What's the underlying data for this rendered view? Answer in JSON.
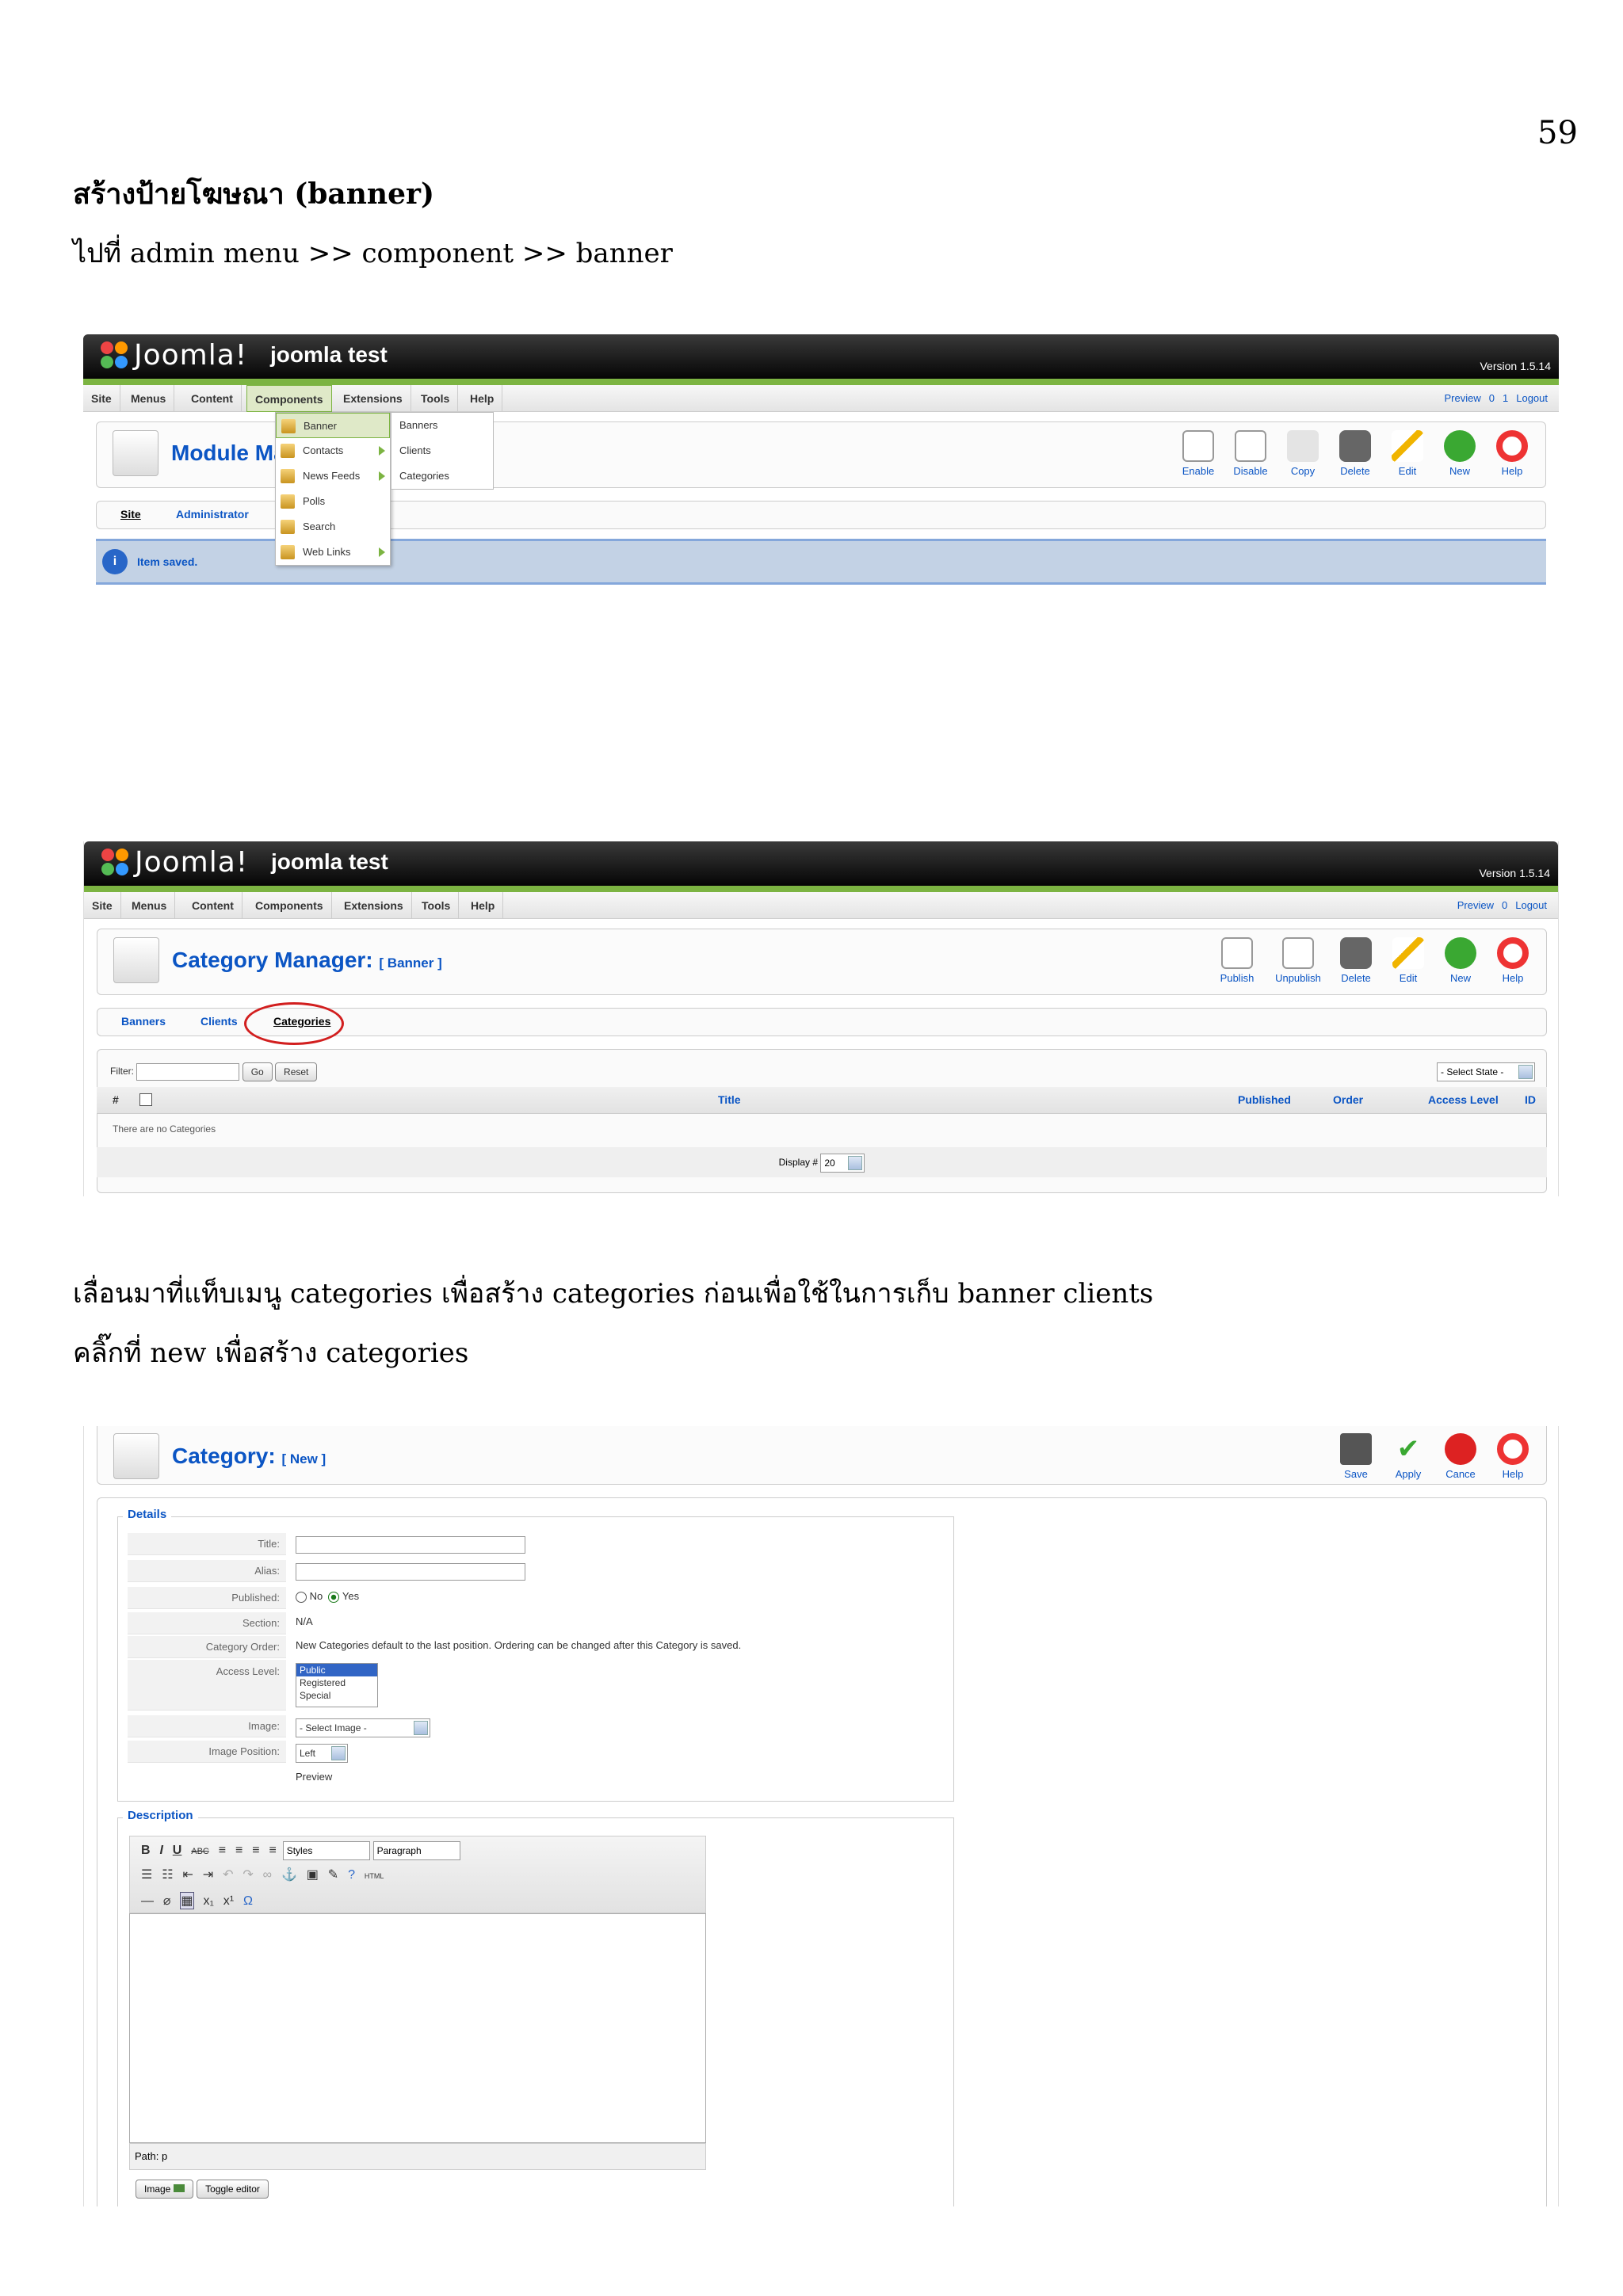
{
  "page": {
    "number": "59",
    "heading": "สร้างป้ายโฆษณา (banner)",
    "subline": "ไปที่ admin menu >> component >> banner",
    "para1": "เลื่อนมาที่แท็บเมนู categories เพื่อสร้าง categories ก่อนเพื่อใช้ในการเก็บ banner clients",
    "para2": "คลิ๊กที่ new เพื่อสร้าง categories"
  },
  "joomla": {
    "logo_text": "Joomla!",
    "site_name": "joomla test",
    "version": "Version 1.5.14",
    "menu": [
      "Site",
      "Menus",
      "Content",
      "Components",
      "Extensions",
      "Tools",
      "Help"
    ],
    "right_links": {
      "preview": "Preview",
      "count1": "0",
      "count2": "1",
      "logout": "Logout"
    }
  },
  "shot1": {
    "page_title": "Module Ma",
    "components_menu": [
      "Banner",
      "Contacts",
      "News Feeds",
      "Polls",
      "Search",
      "Web Links"
    ],
    "banner_submenu": [
      "Banners",
      "Clients",
      "Categories"
    ],
    "toolbar": [
      "Enable",
      "Disable",
      "Copy",
      "Delete",
      "Edit",
      "New",
      "Help"
    ],
    "tabs": [
      "Site",
      "Administrator"
    ],
    "message": "Item saved."
  },
  "shot2": {
    "page_title": "Category Manager:",
    "page_subtitle": "[ Banner ]",
    "toolbar": [
      "Publish",
      "Unpublish",
      "Delete",
      "Edit",
      "New",
      "Help"
    ],
    "tabs": [
      "Banners",
      "Clients",
      "Categories"
    ],
    "filter_label": "Filter:",
    "go_label": "Go",
    "reset_label": "Reset",
    "state_select": "- Select State -",
    "columns": [
      "#",
      "Title",
      "Published",
      "Order",
      "Access Level",
      "ID"
    ],
    "empty_text": "There are no Categories",
    "display_label": "Display #",
    "display_value": "20"
  },
  "shot3": {
    "page_title": "Category:",
    "page_subtitle": "[ New ]",
    "toolbar": [
      "Save",
      "Apply",
      "Cance",
      "Help"
    ],
    "details_legend": "Details",
    "fields": {
      "title": "Title:",
      "alias": "Alias:",
      "published": "Published:",
      "published_no": "No",
      "published_yes": "Yes",
      "section": "Section:",
      "section_value": "N/A",
      "category_order": "Category Order:",
      "category_order_value": "New Categories default to the last position. Ordering can be changed after this Category is saved.",
      "access_level": "Access Level:",
      "access_options": [
        "Public",
        "Registered",
        "Special"
      ],
      "image": "Image:",
      "image_value": "- Select Image -",
      "image_position": "Image Position:",
      "image_position_value": "Left",
      "preview": "Preview"
    },
    "description_legend": "Description",
    "editor_styles": "Styles",
    "editor_paragraph": "Paragraph",
    "path_label": "Path: p",
    "image_button": "Image",
    "toggle_button": "Toggle editor"
  },
  "colors": {
    "accent": "#0b55c4",
    "green_bar": "#7cb442",
    "header_dark": "#111111",
    "message_bg": "#c3d2e5",
    "highlight_circle": "#d21f1f"
  }
}
